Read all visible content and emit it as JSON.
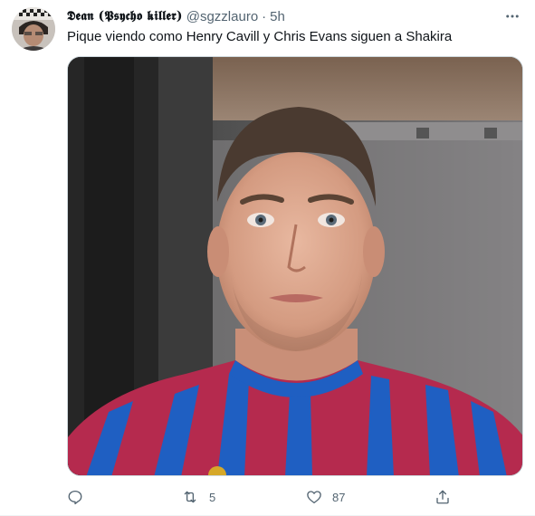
{
  "author": {
    "display_name": "𝕯𝖊𝖆𝖓 (𝕻𝖘𝖞𝖈𝖍𝖔 𝖐𝖎𝖑𝖑𝖊𝖗)",
    "handle": "@sgzzlauro",
    "separator": "·",
    "time": "5h"
  },
  "tweet": {
    "text": "Pique viendo como Henry Cavill y Chris Evans siguen a Shakira"
  },
  "actions": {
    "reply_count": "",
    "retweet_count": "5",
    "like_count": "87"
  },
  "icons": {
    "more": "more-horizontal-icon",
    "reply": "reply-icon",
    "retweet": "retweet-icon",
    "like": "heart-icon",
    "share": "share-icon"
  },
  "colors": {
    "text_primary": "#0f1419",
    "text_secondary": "#536471",
    "border": "#cfd9de"
  }
}
